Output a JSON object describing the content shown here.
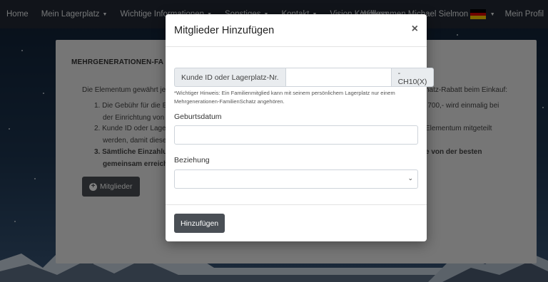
{
  "navbar": {
    "items": [
      {
        "label": "Home",
        "dropdown": false
      },
      {
        "label": "Mein Lagerplatz",
        "dropdown": true
      },
      {
        "label": "Wichtige Informationen",
        "dropdown": true
      },
      {
        "label": "Sonstiges",
        "dropdown": true
      },
      {
        "label": "Kontakt",
        "dropdown": true
      },
      {
        "label": "Vision Kongress",
        "dropdown": false
      }
    ],
    "welcome": "Willkommen Michael Sielmon",
    "profile": "Mein Profil",
    "flag_colors": [
      "#000000",
      "#dd0000",
      "#ffce00"
    ]
  },
  "card": {
    "title": "MEHRGENERATIONEN-FA",
    "intro": "Die Elementum gewährt je",
    "intro_right": "hatz-Rabatt beim Einkauf:",
    "items": [
      {
        "n": "1.",
        "l1": "Die Gebühr für die E",
        "l2": "der Einrichtung von",
        "r1": "€ 700,- wird einmalig bei"
      },
      {
        "n": "2.",
        "l1": "Kunde ID oder Lager",
        "l2": "werden, damit diese",
        "r1": "Elementum mitgeteilt"
      },
      {
        "n": "3.",
        "l1": "Sämtliche Einzahlu",
        "l2": "gemeinsam erreich",
        "r1": "e von der besten",
        "bold": true
      }
    ],
    "members_button": "Mitglieder"
  },
  "modal": {
    "title": "Mitglieder Hinzufügen",
    "close": "×",
    "customer_id_prefix": "Kunde ID oder Lagerplatz-Nr.",
    "customer_id_value": "",
    "customer_id_suffix": "-CH10(X)",
    "hint": "*Wichtiger Hinweis: Ein Familienmitglied kann mit seinem persönlichem Lagerplatz nur einem Mehrgenerationen-FamilienSchatz angehören.",
    "birthdate_label": "Geburtsdatum",
    "birthdate_value": "",
    "relation_label": "Beziehung",
    "relation_value": "",
    "add_button": "Hinzufügen"
  }
}
